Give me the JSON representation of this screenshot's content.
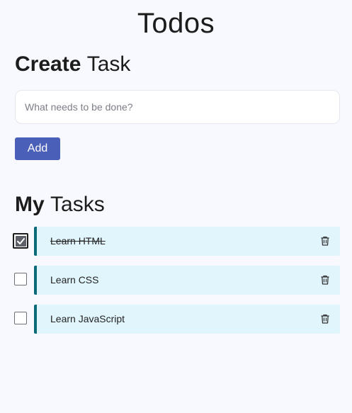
{
  "header": {
    "title": "Todos"
  },
  "create": {
    "heading_bold": "Create",
    "heading_rest": "Task",
    "input_placeholder": "What needs to be done?",
    "input_value": "",
    "add_label": "Add"
  },
  "tasks": {
    "heading_bold": "My",
    "heading_rest": "Tasks",
    "items": [
      {
        "label": "Learn HTML",
        "completed": true,
        "icon": "trash-icon"
      },
      {
        "label": "Learn CSS",
        "completed": false,
        "icon": "trash-icon"
      },
      {
        "label": "Learn JavaScript",
        "completed": false,
        "icon": "trash-icon"
      }
    ]
  },
  "colors": {
    "background": "#f8f9fe",
    "accent_button": "#4a5fb7",
    "task_card": "#e1f5fd",
    "task_border": "#0a6a78"
  }
}
